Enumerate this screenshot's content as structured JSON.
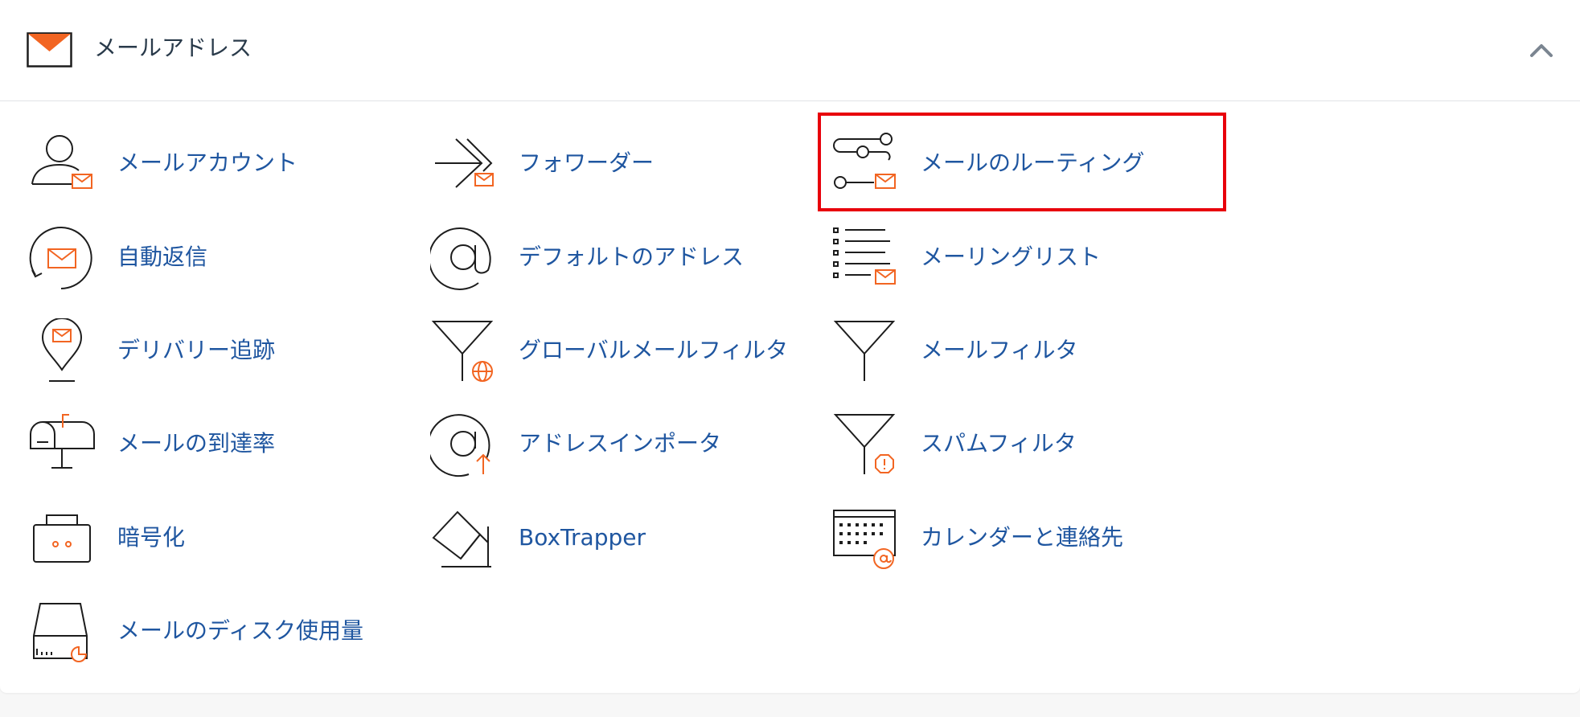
{
  "section": {
    "title": "メールアドレス",
    "icon": "envelope-icon",
    "collapse_icon": "chevron-up-icon"
  },
  "colors": {
    "accent": "#f26522",
    "link": "#1f56a0",
    "icon_stroke": "#1d1d1d",
    "highlight": "#e8000b"
  },
  "items": [
    {
      "label": "メールアカウント",
      "icon": "user-mail-icon"
    },
    {
      "label": "フォワーダー",
      "icon": "forward-arrow-icon"
    },
    {
      "label": "メールのルーティング",
      "icon": "routing-icon"
    },
    {
      "label": "自動返信",
      "icon": "auto-reply-icon"
    },
    {
      "label": "デフォルトのアドレス",
      "icon": "at-sign-icon"
    },
    {
      "label": "メーリングリスト",
      "icon": "list-mail-icon"
    },
    {
      "label": "デリバリー追跡",
      "icon": "map-pin-mail-icon"
    },
    {
      "label": "グローバルメールフィルタ",
      "icon": "funnel-globe-icon"
    },
    {
      "label": "メールフィルタ",
      "icon": "funnel-icon"
    },
    {
      "label": "メールの到達率",
      "icon": "mailbox-icon"
    },
    {
      "label": "アドレスインポータ",
      "icon": "at-import-icon"
    },
    {
      "label": "スパムフィルタ",
      "icon": "funnel-alert-icon"
    },
    {
      "label": "暗号化",
      "icon": "briefcase-lock-icon"
    },
    {
      "label": "BoxTrapper",
      "icon": "eraser-icon"
    },
    {
      "label": "カレンダーと連絡先",
      "icon": "calendar-at-icon"
    },
    {
      "label": "メールのディスク使用量",
      "icon": "disk-usage-icon"
    }
  ]
}
